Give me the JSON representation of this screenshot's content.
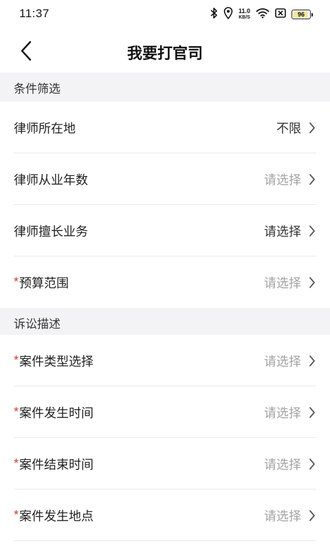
{
  "status_bar": {
    "time": "11:37",
    "net_speed_value": "11.0",
    "net_speed_unit": "KB/S",
    "battery_level": "96",
    "icons": [
      "bluetooth-icon",
      "location-icon",
      "wifi-icon",
      "no-sim-icon",
      "battery-icon"
    ]
  },
  "header": {
    "title": "我要打官司",
    "back_icon": "chevron-left-icon"
  },
  "sections": {
    "filter": {
      "title": "条件筛选",
      "rows": [
        {
          "label": "律师所在地",
          "value": "不限",
          "required": false
        },
        {
          "label": "律师从业年数",
          "value": "请选择",
          "required": false
        },
        {
          "label": "律师擅长业务",
          "value": "请选择",
          "required": false
        },
        {
          "label": "预算范围",
          "value": "请选择",
          "required": true
        }
      ]
    },
    "description": {
      "title": "诉讼描述",
      "rows": [
        {
          "label": "案件类型选择",
          "value": "请选择",
          "required": true
        },
        {
          "label": "案件发生时间",
          "value": "请选择",
          "required": true
        },
        {
          "label": "案件结束时间",
          "value": "请选择",
          "required": true
        },
        {
          "label": "案件发生地点",
          "value": "请选择",
          "required": true
        }
      ]
    }
  },
  "required_mark": "*",
  "colors": {
    "required": "#d33a2c",
    "placeholder": "#a3a3a3",
    "section_bg": "#f3f3f5"
  }
}
